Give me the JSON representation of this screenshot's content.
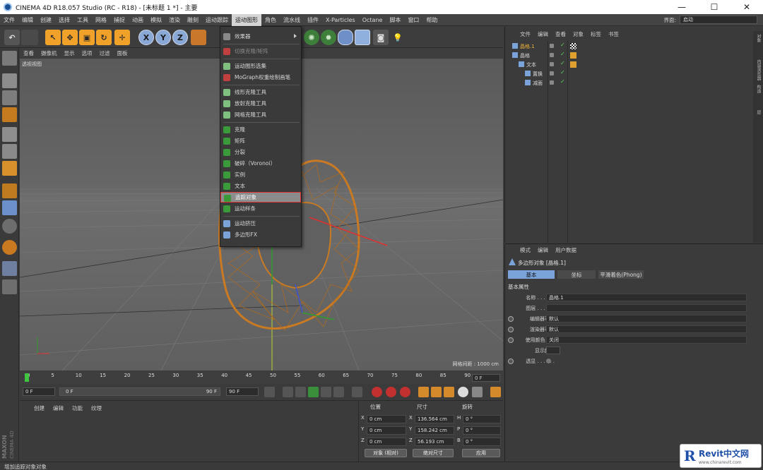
{
  "window": {
    "title": "CINEMA 4D R18.057 Studio (RC - R18) - [未标题 1 *] - 主要",
    "minimize": "—",
    "maximize": "☐",
    "close": "✕"
  },
  "menubar": {
    "items": [
      "文件",
      "编辑",
      "创建",
      "选择",
      "工具",
      "网格",
      "捕捉",
      "动画",
      "模拟",
      "渲染",
      "雕刻",
      "运动跟踪",
      "运动图形",
      "角色",
      "流水线",
      "插件",
      "X-Particles",
      "Octane",
      "脚本",
      "窗口",
      "帮助"
    ],
    "active_index": 12,
    "layout_label": "界面:",
    "layout_value": "启动"
  },
  "dropdown": {
    "items": [
      {
        "label": "效果器",
        "icon": "effector-icon",
        "state": "submenu"
      },
      {
        "label": "切换克隆/矩阵",
        "icon": "toggle-clone-icon",
        "state": "normal"
      },
      {
        "label": "运动图形选集",
        "icon": "mograph-selection-icon",
        "state": "normal"
      },
      {
        "label": "MoGraph权重绘制画笔",
        "icon": "weight-brush-icon",
        "state": "normal"
      },
      {
        "label": "线形克隆工具",
        "icon": "linear-clone-icon",
        "state": "normal"
      },
      {
        "label": "放射克隆工具",
        "icon": "radial-clone-icon",
        "state": "normal"
      },
      {
        "label": "网格克隆工具",
        "icon": "grid-clone-icon",
        "state": "normal"
      },
      {
        "label": "克隆",
        "icon": "cloner-icon",
        "state": "normal"
      },
      {
        "label": "矩阵",
        "icon": "matrix-icon",
        "state": "normal"
      },
      {
        "label": "分裂",
        "icon": "fracture-icon",
        "state": "normal"
      },
      {
        "label": "破碎（Voronoi）",
        "icon": "voronoi-icon",
        "state": "normal"
      },
      {
        "label": "实例",
        "icon": "instance-icon",
        "state": "normal"
      },
      {
        "label": "文本",
        "icon": "text-icon",
        "state": "normal"
      },
      {
        "label": "追踪对象",
        "icon": "tracer-icon",
        "state": "highlight"
      },
      {
        "label": "运动样条",
        "icon": "motion-spline-icon",
        "state": "normal"
      },
      {
        "label": "运动挤压",
        "icon": "motion-extrude-icon",
        "state": "normal"
      },
      {
        "label": "多边形FX",
        "icon": "poly-fx-icon",
        "state": "normal"
      }
    ]
  },
  "viewport": {
    "menu": [
      "查看",
      "摄像机",
      "显示",
      "选项",
      "过滤",
      "面板"
    ],
    "label": "透视视图",
    "grid_label": "网格间距 : 1000 cm"
  },
  "object_manager": {
    "menu": [
      "文件",
      "编辑",
      "查看",
      "对象",
      "标签",
      "书签"
    ],
    "rows": [
      {
        "name": "晶格.1",
        "indent": 0,
        "color": "#f0b43c"
      },
      {
        "name": "晶格",
        "indent": 0,
        "color": "#d8d8d8"
      },
      {
        "name": "文本",
        "indent": 1,
        "color": "#d8d8d8"
      },
      {
        "name": "置换",
        "indent": 2,
        "color": "#d8d8d8"
      },
      {
        "name": "减面",
        "indent": 2,
        "color": "#d8d8d8"
      }
    ],
    "side_tabs": [
      "对象",
      "内容浏览器",
      "构造",
      "层"
    ]
  },
  "attributes": {
    "menu": [
      "模式",
      "编辑",
      "用户数据"
    ],
    "title": "多边形对象 [晶格.1]",
    "tabs": [
      "基本",
      "坐标",
      "平滑着色(Phong)"
    ],
    "active_tab": 0,
    "section": "基本属性",
    "rows": [
      {
        "label": "名称 . . . . . .",
        "value": "晶格.1",
        "radio": false
      },
      {
        "label": "图层 . . . . . .",
        "value": "",
        "radio": false
      },
      {
        "label": "编辑器可见",
        "value": "默认",
        "radio": true
      },
      {
        "label": "渲染器可见",
        "value": "默认",
        "radio": true
      },
      {
        "label": "使用颜色 . . .",
        "value": "关闭",
        "radio": true
      },
      {
        "label": "显示颜色",
        "value": "",
        "radio": false
      },
      {
        "label": "透显 . . . . . .",
        "value": "",
        "radio": true
      }
    ]
  },
  "timeline": {
    "ticks": [
      "0",
      "5",
      "10",
      "15",
      "20",
      "25",
      "30",
      "35",
      "40",
      "45",
      "50",
      "55",
      "60",
      "65",
      "70",
      "75",
      "80",
      "85",
      "90"
    ],
    "frame_end_label": "0 F",
    "start_field": "0 F",
    "range_start": "0 F",
    "range_end": "90 F",
    "end_field": "90 F"
  },
  "material_manager": {
    "menu": [
      "创建",
      "编辑",
      "功能",
      "纹理"
    ]
  },
  "coordinates": {
    "headers": [
      "位置",
      "尺寸",
      "旋转"
    ],
    "rows": [
      {
        "axis": "X",
        "pos": "0 cm",
        "size_axis": "X",
        "size": "136.564 cm",
        "rot_axis": "H",
        "rot": "0 °"
      },
      {
        "axis": "Y",
        "pos": "0 cm",
        "size_axis": "Y",
        "size": "158.242 cm",
        "rot_axis": "P",
        "rot": "0 °"
      },
      {
        "axis": "Z",
        "pos": "0 cm",
        "size_axis": "Z",
        "size": "56.193 cm",
        "rot_axis": "B",
        "rot": "0 °"
      }
    ],
    "mode": "对象 (相对)",
    "size_mode": "绝对尺寸",
    "apply": "应用"
  },
  "status": {
    "text": "增加追踪对象对象"
  },
  "branding": {
    "maxon": "MAXON",
    "cinema": "CINEMA 4D",
    "watermark_brand": "Revit中文网",
    "watermark_url": "www.chinarevit.com"
  }
}
